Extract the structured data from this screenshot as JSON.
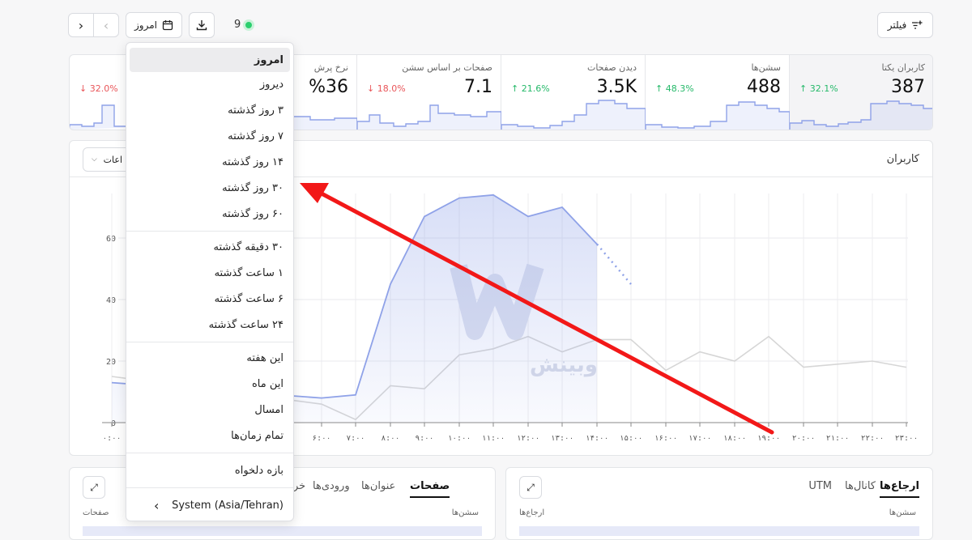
{
  "toolbar": {
    "filter_label": "فیلتر",
    "date_label": "امروز",
    "online_count": "9"
  },
  "stats": [
    {
      "title": "کاربران یکتا",
      "value": "387",
      "change": "32.1%",
      "dir": "up"
    },
    {
      "title": "سشن‌ها",
      "value": "488",
      "change": "48.3%",
      "dir": "up"
    },
    {
      "title": "دیدن صفحات",
      "value": "3.5K",
      "change": "21.6%",
      "dir": "up"
    },
    {
      "title": "صفحات بر اساس سشن",
      "value": "7.1",
      "change": "18.0%",
      "dir": "down"
    },
    {
      "title": "نرخ پرش",
      "value": "%36",
      "change": "32.0%",
      "dir": "down"
    }
  ],
  "chart_section": {
    "title": "کاربران",
    "select_text": "اعات"
  },
  "chart_data": {
    "type": "line",
    "ylim": [
      0,
      80
    ],
    "yticks": [
      "0",
      "20",
      "40",
      "60"
    ],
    "x": [
      "0:00",
      "6:00",
      "7:00",
      "8:00",
      "9:00",
      "10:00",
      "11:00",
      "12:00",
      "13:00",
      "14:00",
      "15:00",
      "16:00",
      "17:00",
      "18:00",
      "19:00",
      "20:00",
      "21:00",
      "22:00",
      "23:00"
    ],
    "xtick_labels": [
      "۰:۰۰",
      "۶:۰۰",
      "۷:۰۰",
      "۸:۰۰",
      "۹:۰۰",
      "۱۰:۰۰",
      "۱۱:۰۰",
      "۱۲:۰۰",
      "۱۳:۰۰",
      "۱۴:۰۰",
      "۱۵:۰۰",
      "۱۶:۰۰",
      "۱۷:۰۰",
      "۱۸:۰۰",
      "۱۹:۰۰",
      "۲۰:۰۰",
      "۲۱:۰۰",
      "۲۲:۰۰",
      "۲۳:۰۰"
    ],
    "series": [
      {
        "values": [
          13,
          8,
          9,
          45,
          67,
          73,
          74,
          67,
          70,
          58,
          45,
          null,
          null,
          null,
          null,
          null,
          null,
          null,
          null
        ],
        "color": "#8fa2e8"
      },
      {
        "values": [
          15,
          6,
          1,
          12,
          11,
          22,
          24,
          28,
          23,
          27,
          27,
          17,
          23,
          20,
          28,
          18,
          19,
          20,
          18
        ],
        "color": "#d6d6d6"
      }
    ]
  },
  "watermark": "وبینش",
  "menu": {
    "items": [
      "امروز",
      "دیروز",
      "۳ روز گذشته",
      "۷ روز گذشته",
      "۱۴ روز گذشته",
      "۳۰ روز گذشته",
      "۶۰ روز گذشته",
      "۳۰ دقیقه گذشته",
      "۱ ساعت گذشته",
      "۶ ساعت گذشته",
      "۲۴ ساعت گذشته",
      "این هفته",
      "این ماه",
      "امسال",
      "تمام زمان‌ها",
      "بازه دلخواه"
    ],
    "timezone": "System (Asia/Tehran)"
  },
  "left_panel": {
    "tabs": [
      "صفحات",
      "عنوان‌ها",
      "ورودی‌ها",
      "خروجی‌ها"
    ],
    "col_sessions": "سشن‌ها",
    "col_pages": "صفحات"
  },
  "right_panel": {
    "tabs": [
      "ارجاع‌ها",
      "کانال‌ها",
      "UTM"
    ],
    "col_sessions": "سشن‌ها",
    "col_referrers": "ارجاع‌ها"
  }
}
